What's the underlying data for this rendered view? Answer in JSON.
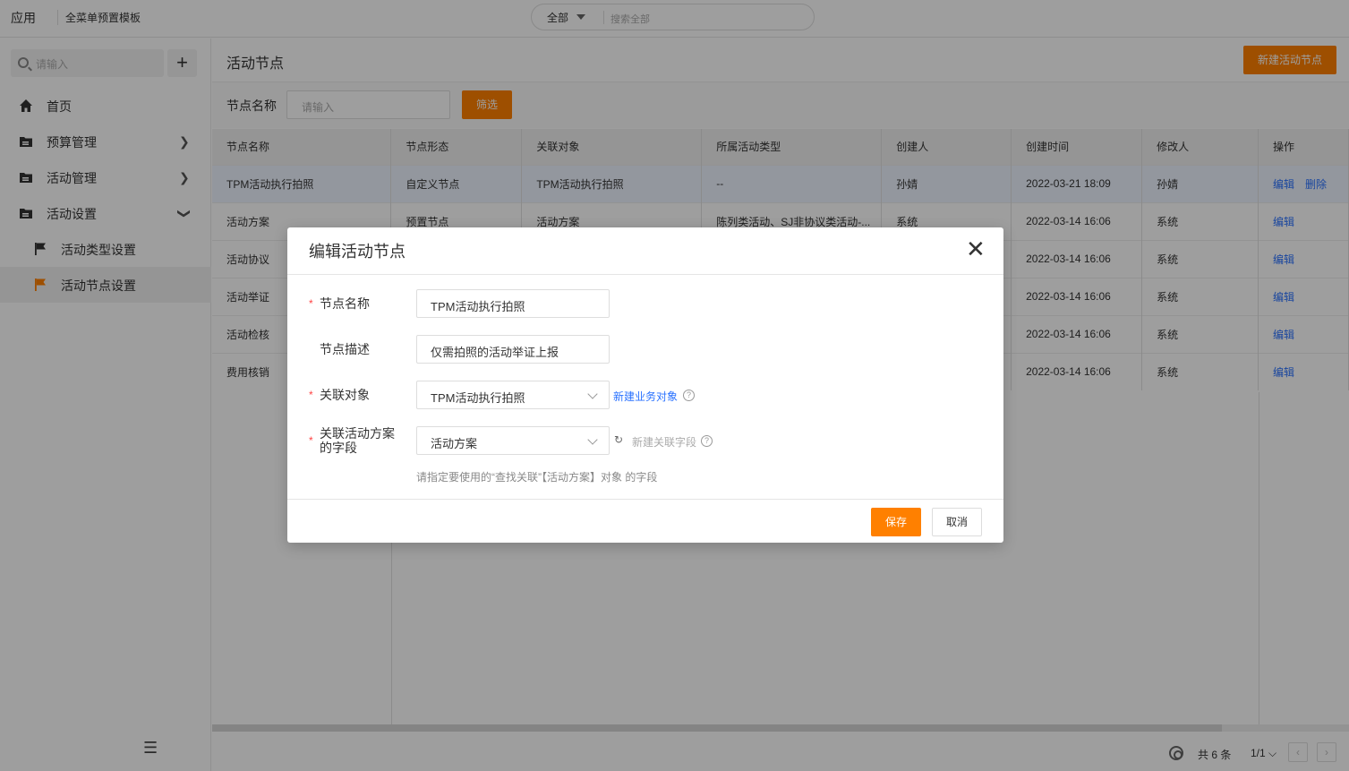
{
  "topbar": {
    "app_label": "应用",
    "template_label": "全菜单预置模板",
    "search": {
      "scope": "全部",
      "placeholder": "搜索全部"
    }
  },
  "sidebar": {
    "search_placeholder": "请输入",
    "add_label": "+",
    "items": [
      {
        "label": "首页",
        "icon": "home-icon"
      },
      {
        "label": "预算管理",
        "icon": "folder-icon"
      },
      {
        "label": "活动管理",
        "icon": "folder-icon"
      },
      {
        "label": "活动设置",
        "icon": "folder-icon"
      },
      {
        "label": "活动类型设置",
        "icon": "flag-icon"
      },
      {
        "label": "活动节点设置",
        "icon": "flag-icon"
      }
    ],
    "active_item": "活动节点设置"
  },
  "main": {
    "title": "活动节点",
    "new_button": "新建活动节点",
    "filter": {
      "label": "节点名称",
      "placeholder": "请输入",
      "button": "筛选"
    },
    "columns": [
      "节点名称",
      "节点形态",
      "关联对象",
      "所属活动类型",
      "创建人",
      "创建时间",
      "修改人",
      "操作"
    ],
    "rows": [
      [
        "TPM活动执行拍照",
        "自定义节点",
        "TPM活动执行拍照",
        "--",
        "孙婧",
        "2022-03-21 18:09",
        "孙婧"
      ],
      [
        "活动方案",
        "预置节点",
        "活动方案",
        "陈列类活动、SJ非协议类活动-...",
        "系统",
        "2022-03-14 16:06",
        "系统"
      ],
      [
        "活动协议",
        "",
        "",
        "",
        "",
        "2022-03-14 16:06",
        "系统"
      ],
      [
        "活动举证",
        "",
        "",
        "",
        "",
        "2022-03-14 16:06",
        "系统"
      ],
      [
        "活动检核",
        "",
        "",
        "",
        "",
        "2022-03-14 16:06",
        "系统"
      ],
      [
        "费用核销",
        "",
        "",
        "",
        "",
        "2022-03-14 16:06",
        "系统"
      ]
    ],
    "action_edit": "编辑",
    "action_delete": "删除",
    "footer": {
      "total": "共 6 条",
      "page": "1/1"
    }
  },
  "modal": {
    "title": "编辑活动节点",
    "fields": {
      "name": {
        "label": "节点名称",
        "value": "TPM活动执行拍照",
        "required": true
      },
      "desc": {
        "label": "节点描述",
        "value": "仅需拍照的活动举证上报",
        "required": false
      },
      "object": {
        "label": "关联对象",
        "value": "TPM活动执行拍照",
        "required": true,
        "link": "新建业务对象"
      },
      "field": {
        "label_line1": "关联活动方案",
        "label_line2": "的字段",
        "value": "活动方案",
        "required": true,
        "link": "新建关联字段"
      }
    },
    "helper": "请指定要使用的“查找关联”【活动方案】对象 的字段",
    "save": "保存",
    "cancel": "取消"
  },
  "colors": {
    "accent": "#ff8000",
    "link": "#2a72ff",
    "required": "#ff4444"
  }
}
